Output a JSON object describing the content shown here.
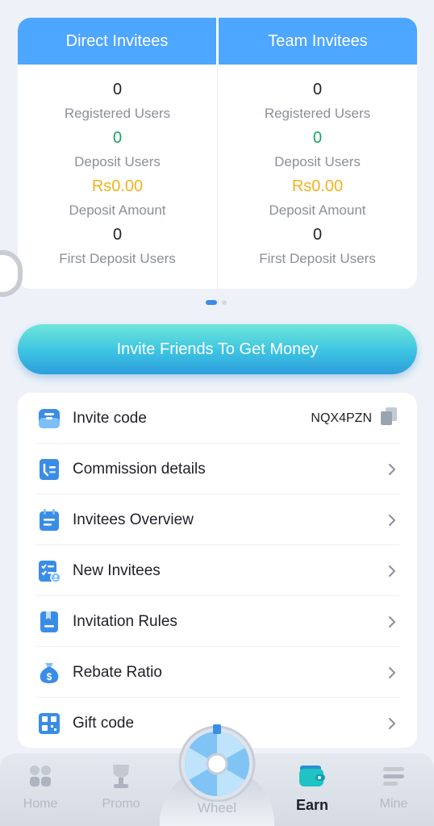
{
  "stats": {
    "direct_title": "Direct Invitees",
    "team_title": "Team Invitees",
    "direct": [
      {
        "value": "0",
        "label": "Registered Users"
      },
      {
        "value": "0",
        "label": "Deposit Users"
      },
      {
        "value": "Rs0.00",
        "label": "Deposit Amount"
      },
      {
        "value": "0",
        "label": "First Deposit Users"
      }
    ],
    "team": [
      {
        "value": "0",
        "label": "Registered Users"
      },
      {
        "value": "0",
        "label": "Deposit Users"
      },
      {
        "value": "Rs0.00",
        "label": "Deposit Amount"
      },
      {
        "value": "0",
        "label": "First Deposit Users"
      }
    ]
  },
  "invite_button": "Invite Friends To Get Money",
  "menu": {
    "items": [
      {
        "label": "Invite code",
        "icon": "invite-code-icon"
      },
      {
        "label": "Commission details",
        "icon": "commission-icon"
      },
      {
        "label": "Invitees Overview",
        "icon": "calendar-icon"
      },
      {
        "label": "New Invitees",
        "icon": "checklist-user-icon"
      },
      {
        "label": "Invitation Rules",
        "icon": "rules-book-icon"
      },
      {
        "label": "Rebate Ratio",
        "icon": "money-bag-icon"
      },
      {
        "label": "Gift code",
        "icon": "qr-code-icon"
      }
    ],
    "invite_code_value": "NQX4PZN"
  },
  "nav": {
    "home": "Home",
    "promo": "Promo",
    "wheel": "Wheel",
    "earn": "Earn",
    "mine": "Mine"
  },
  "colors": {
    "accent_blue": "#4da6ff",
    "green_value": "#1aa45c",
    "gold_value": "#f2b21e"
  }
}
